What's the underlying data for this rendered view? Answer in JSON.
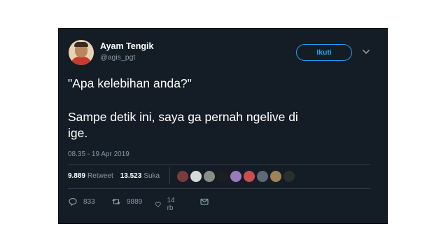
{
  "tweet": {
    "author_name": "Ayam Tengik",
    "author_handle": "@agis_pgt",
    "follow_label": "Ikuti",
    "text_line1": "\"Apa kelebihan anda?\"",
    "text_line2": "Sampe detik ini, saya ga pernah ngelive di",
    "text_line3": "ige.",
    "timestamp": "08.35 - 19 Apr 2019"
  },
  "stats": {
    "retweets_count": "9.889",
    "retweets_label": "Retweet",
    "likes_count": "13.523",
    "likes_label": "Suka"
  },
  "liker_avatars": [
    {
      "name": "avatar-1",
      "color": "#7a3b3b"
    },
    {
      "name": "avatar-2",
      "color": "#d9d9d9"
    },
    {
      "name": "avatar-3",
      "color": "#8a8f86"
    },
    {
      "name": "avatar-4",
      "color": "#1e1e1e"
    },
    {
      "name": "avatar-5",
      "color": "#9a7ab8"
    },
    {
      "name": "avatar-6",
      "color": "#c94f4f"
    },
    {
      "name": "avatar-7",
      "color": "#5e6b77"
    },
    {
      "name": "avatar-8",
      "color": "#a08257"
    },
    {
      "name": "avatar-9",
      "color": "#2b2f2b"
    }
  ],
  "actions": {
    "reply_count": "833",
    "retweet_count": "9889",
    "like_count": "14 rb"
  },
  "colors": {
    "card_bg": "#141d26",
    "accent": "#1da1f2",
    "muted_text": "#8899a6",
    "divider": "#2f3e4c"
  }
}
